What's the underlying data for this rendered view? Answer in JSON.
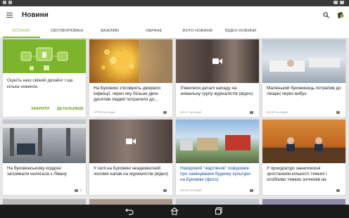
{
  "app": {
    "title": "Новини"
  },
  "icons": {
    "menu": "menu-icon",
    "search": "search-icon",
    "logo": "app-logo-icon",
    "video": "video-play-icon",
    "comments": "comment-bubble-icon"
  },
  "status_bar": {
    "time": "",
    "battery": ""
  },
  "tabs": [
    {
      "label": "ОСТАННІ",
      "active": true
    },
    {
      "label": "ОБГОВОРЮВАНІ",
      "active": false
    },
    {
      "label": "ВАЖЛИВІ",
      "active": false
    },
    {
      "label": "ОБРАНЕ",
      "active": false
    },
    {
      "label": "ФОТО НОВИНИ",
      "active": false
    },
    {
      "label": "ВІДЕО НОВИНИ",
      "active": false
    }
  ],
  "promo": {
    "text": "Оцініть наш свіжий дизайн! І ще кілька новинок.",
    "close_label": "ЗАКРИТИ",
    "details_label": "ДЕТАЛЬНІШЕ"
  },
  "cards": [
    {
      "title": "На Буковині з'ясовують джерело інфекції, через яку більше двох десятків людей потрапило до...",
      "meta": "17:00 сьогодні",
      "comments": "",
      "video": false
    },
    {
      "title": "З'явилися деталі нападу на знімальну групу журналістів (відео)",
      "meta": "16:47 сьогодні",
      "comments": "",
      "video": true
    },
    {
      "title": "Маленький буковинець потрапив до лікарні через вибух",
      "meta": "16:30 сьогодні",
      "comments": "",
      "video": false
    },
    {
      "title": "На буковинському кордоні затримали нелегала з Лівану",
      "meta": "",
      "comments": "0",
      "video": false
    },
    {
      "title": "У селі на Буковині неадекватний чоловік напав на журналістів (відео)",
      "meta": "",
      "comments": "",
      "video": true
    },
    {
      "title": "Невідомий \"жартівник\" повідомив про замінування будинку культури на Буковині (фото)",
      "meta": "16:00 сьогодні",
      "comments": "",
      "video": false
    },
    {
      "title": "У прокуратурі занепокоєні зростанням кількості тяжких і особливо тяжких злочинів на",
      "meta": "",
      "comments": "",
      "video": false
    }
  ]
}
